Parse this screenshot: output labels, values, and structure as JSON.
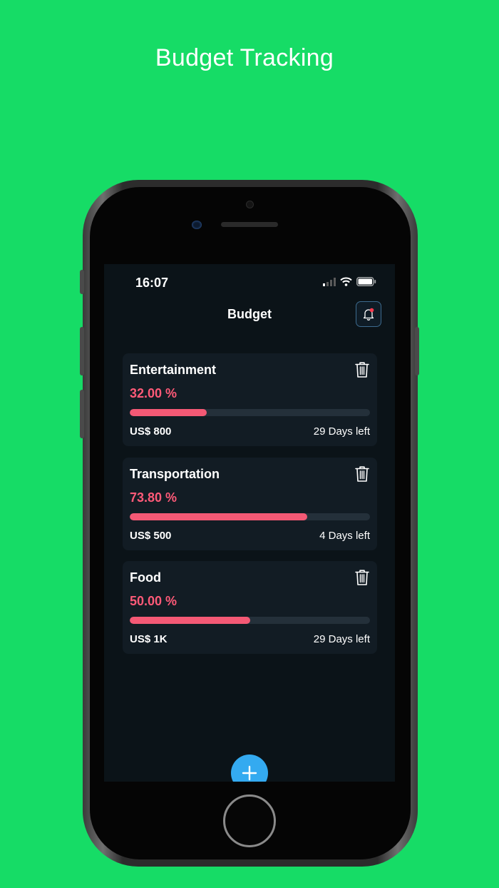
{
  "promo": {
    "title": "Budget Tracking"
  },
  "status_bar": {
    "time": "16:07",
    "icons": [
      "cellular-signal-icon",
      "wifi-icon",
      "battery-icon"
    ]
  },
  "header": {
    "title": "Budget",
    "notification_icon": "bell-icon"
  },
  "colors": {
    "background": "#16dc66",
    "screen": "#0b1318",
    "card": "#121c24",
    "accent_percent": "#ff5a78",
    "progress_fill": "#f45975",
    "fab": "#34aaf0"
  },
  "budgets": [
    {
      "name": "Entertainment",
      "percent_label": "32.00  %",
      "progress": 0.32,
      "amount": "US$ 800",
      "days_left": "29 Days left"
    },
    {
      "name": "Transportation",
      "percent_label": "73.80  %",
      "progress": 0.738,
      "amount": "US$ 500",
      "days_left": "4 Days left"
    },
    {
      "name": "Food",
      "percent_label": "50.00  %",
      "progress": 0.5,
      "amount": "US$ 1K",
      "days_left": "29 Days left"
    }
  ],
  "fab": {
    "icon": "plus-icon"
  }
}
